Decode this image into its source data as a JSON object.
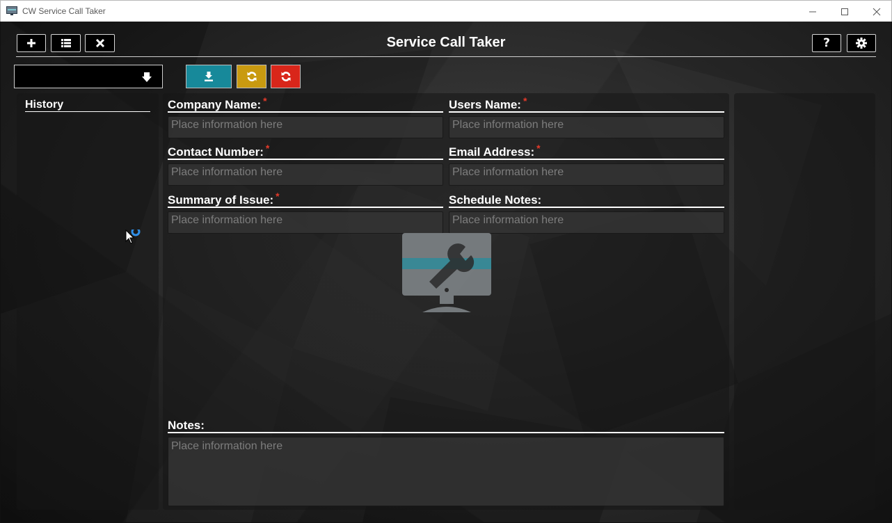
{
  "window": {
    "title": "CW Service Call Taker",
    "minimize_glyph": "—",
    "maximize_glyph": "☐",
    "close_glyph": "✕"
  },
  "header": {
    "title": "Service Call Taker",
    "left_buttons": [
      {
        "icon": "plus-icon",
        "glyph": "✚"
      },
      {
        "icon": "list-icon",
        "glyph": "☰"
      },
      {
        "icon": "close-icon",
        "glyph": "✖"
      }
    ],
    "right_buttons": [
      {
        "icon": "question-icon",
        "glyph": "?"
      },
      {
        "icon": "gear-icon",
        "glyph": "⚙"
      }
    ]
  },
  "toolbar": {
    "dropdown_value": "",
    "actions": [
      {
        "icon": "download-icon",
        "color": "#17899a"
      },
      {
        "icon": "refresh-icon",
        "color": "#c99a10"
      },
      {
        "icon": "refresh-icon",
        "color": "#d9261a"
      }
    ]
  },
  "history": {
    "title": "History"
  },
  "form": {
    "required_marker": "*",
    "fields": [
      {
        "label": "Company Name:",
        "required": true,
        "placeholder": "Place information here"
      },
      {
        "label": "Users Name:",
        "required": true,
        "placeholder": "Place information here"
      },
      {
        "label": "Contact Number:",
        "required": true,
        "placeholder": "Place information here"
      },
      {
        "label": "Email Address:",
        "required": true,
        "placeholder": "Place information here"
      },
      {
        "label": "Summary of Issue:",
        "required": true,
        "placeholder": "Place information here"
      },
      {
        "label": "Schedule Notes:",
        "required": false,
        "placeholder": "Place information here"
      }
    ],
    "notes": {
      "label": "Notes:",
      "placeholder": "Place information here"
    }
  },
  "colors": {
    "accent_teal": "#17899a",
    "accent_gold": "#c99a10",
    "accent_red": "#d9261a",
    "required": "#e53a2a"
  }
}
